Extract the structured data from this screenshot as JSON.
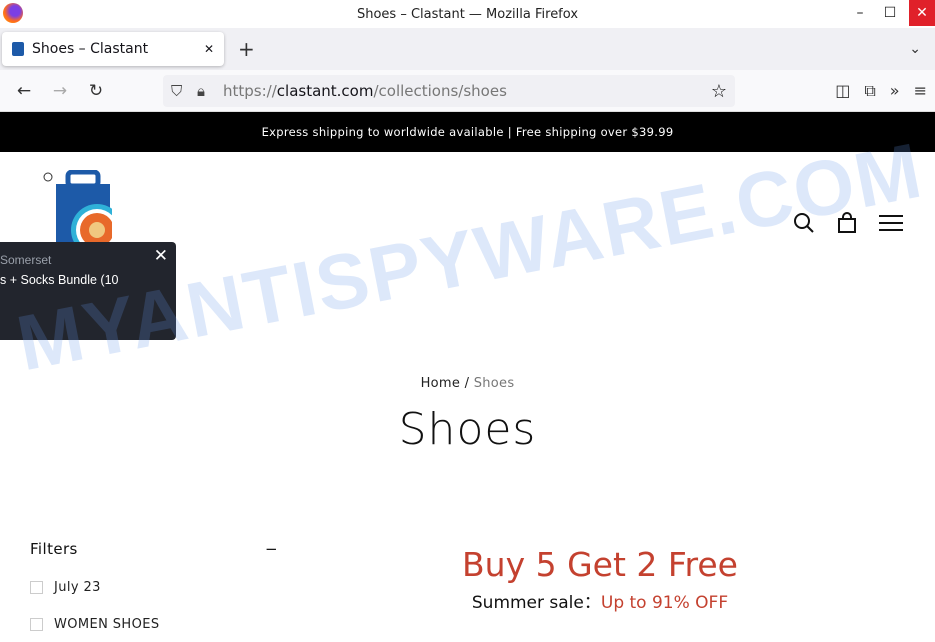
{
  "window": {
    "title": "Shoes – Clastant — Mozilla Firefox",
    "min": "–",
    "max": "☐",
    "close": "✕"
  },
  "tab": {
    "label": "Shoes – Clastant",
    "close": "✕",
    "new": "+",
    "list": "⌄"
  },
  "nav": {
    "back": "←",
    "forward": "→",
    "reload": "↻",
    "url_prefix": "https://",
    "url_domain": "clastant.com",
    "url_path": "/collections/shoes",
    "star": "☆",
    "pocket": "◫",
    "extensions": "⧉",
    "more": "»",
    "menu": "≡"
  },
  "announcement": "Express shipping to worldwide available | Free shipping over $39.99",
  "popup": {
    "location": "Somerset",
    "product": "s + Socks Bundle (10",
    "close": "✕"
  },
  "breadcrumb": {
    "home": "Home",
    "sep": " / ",
    "current": "Shoes"
  },
  "page_title": "Shoes",
  "filters": {
    "title": "Filters",
    "toggle": "−",
    "items": [
      "July 23",
      "WOMEN SHOES"
    ]
  },
  "promo": {
    "headline": "Buy 5 Get 2 Free",
    "sub_label": "Summer sale：",
    "sub_value": "Up to 91% OFF"
  },
  "watermark": "MYANTISPYWARE.COM",
  "colors": {
    "accent": "#c4412f",
    "announce_bg": "#000000",
    "close_red": "#e0212a"
  }
}
